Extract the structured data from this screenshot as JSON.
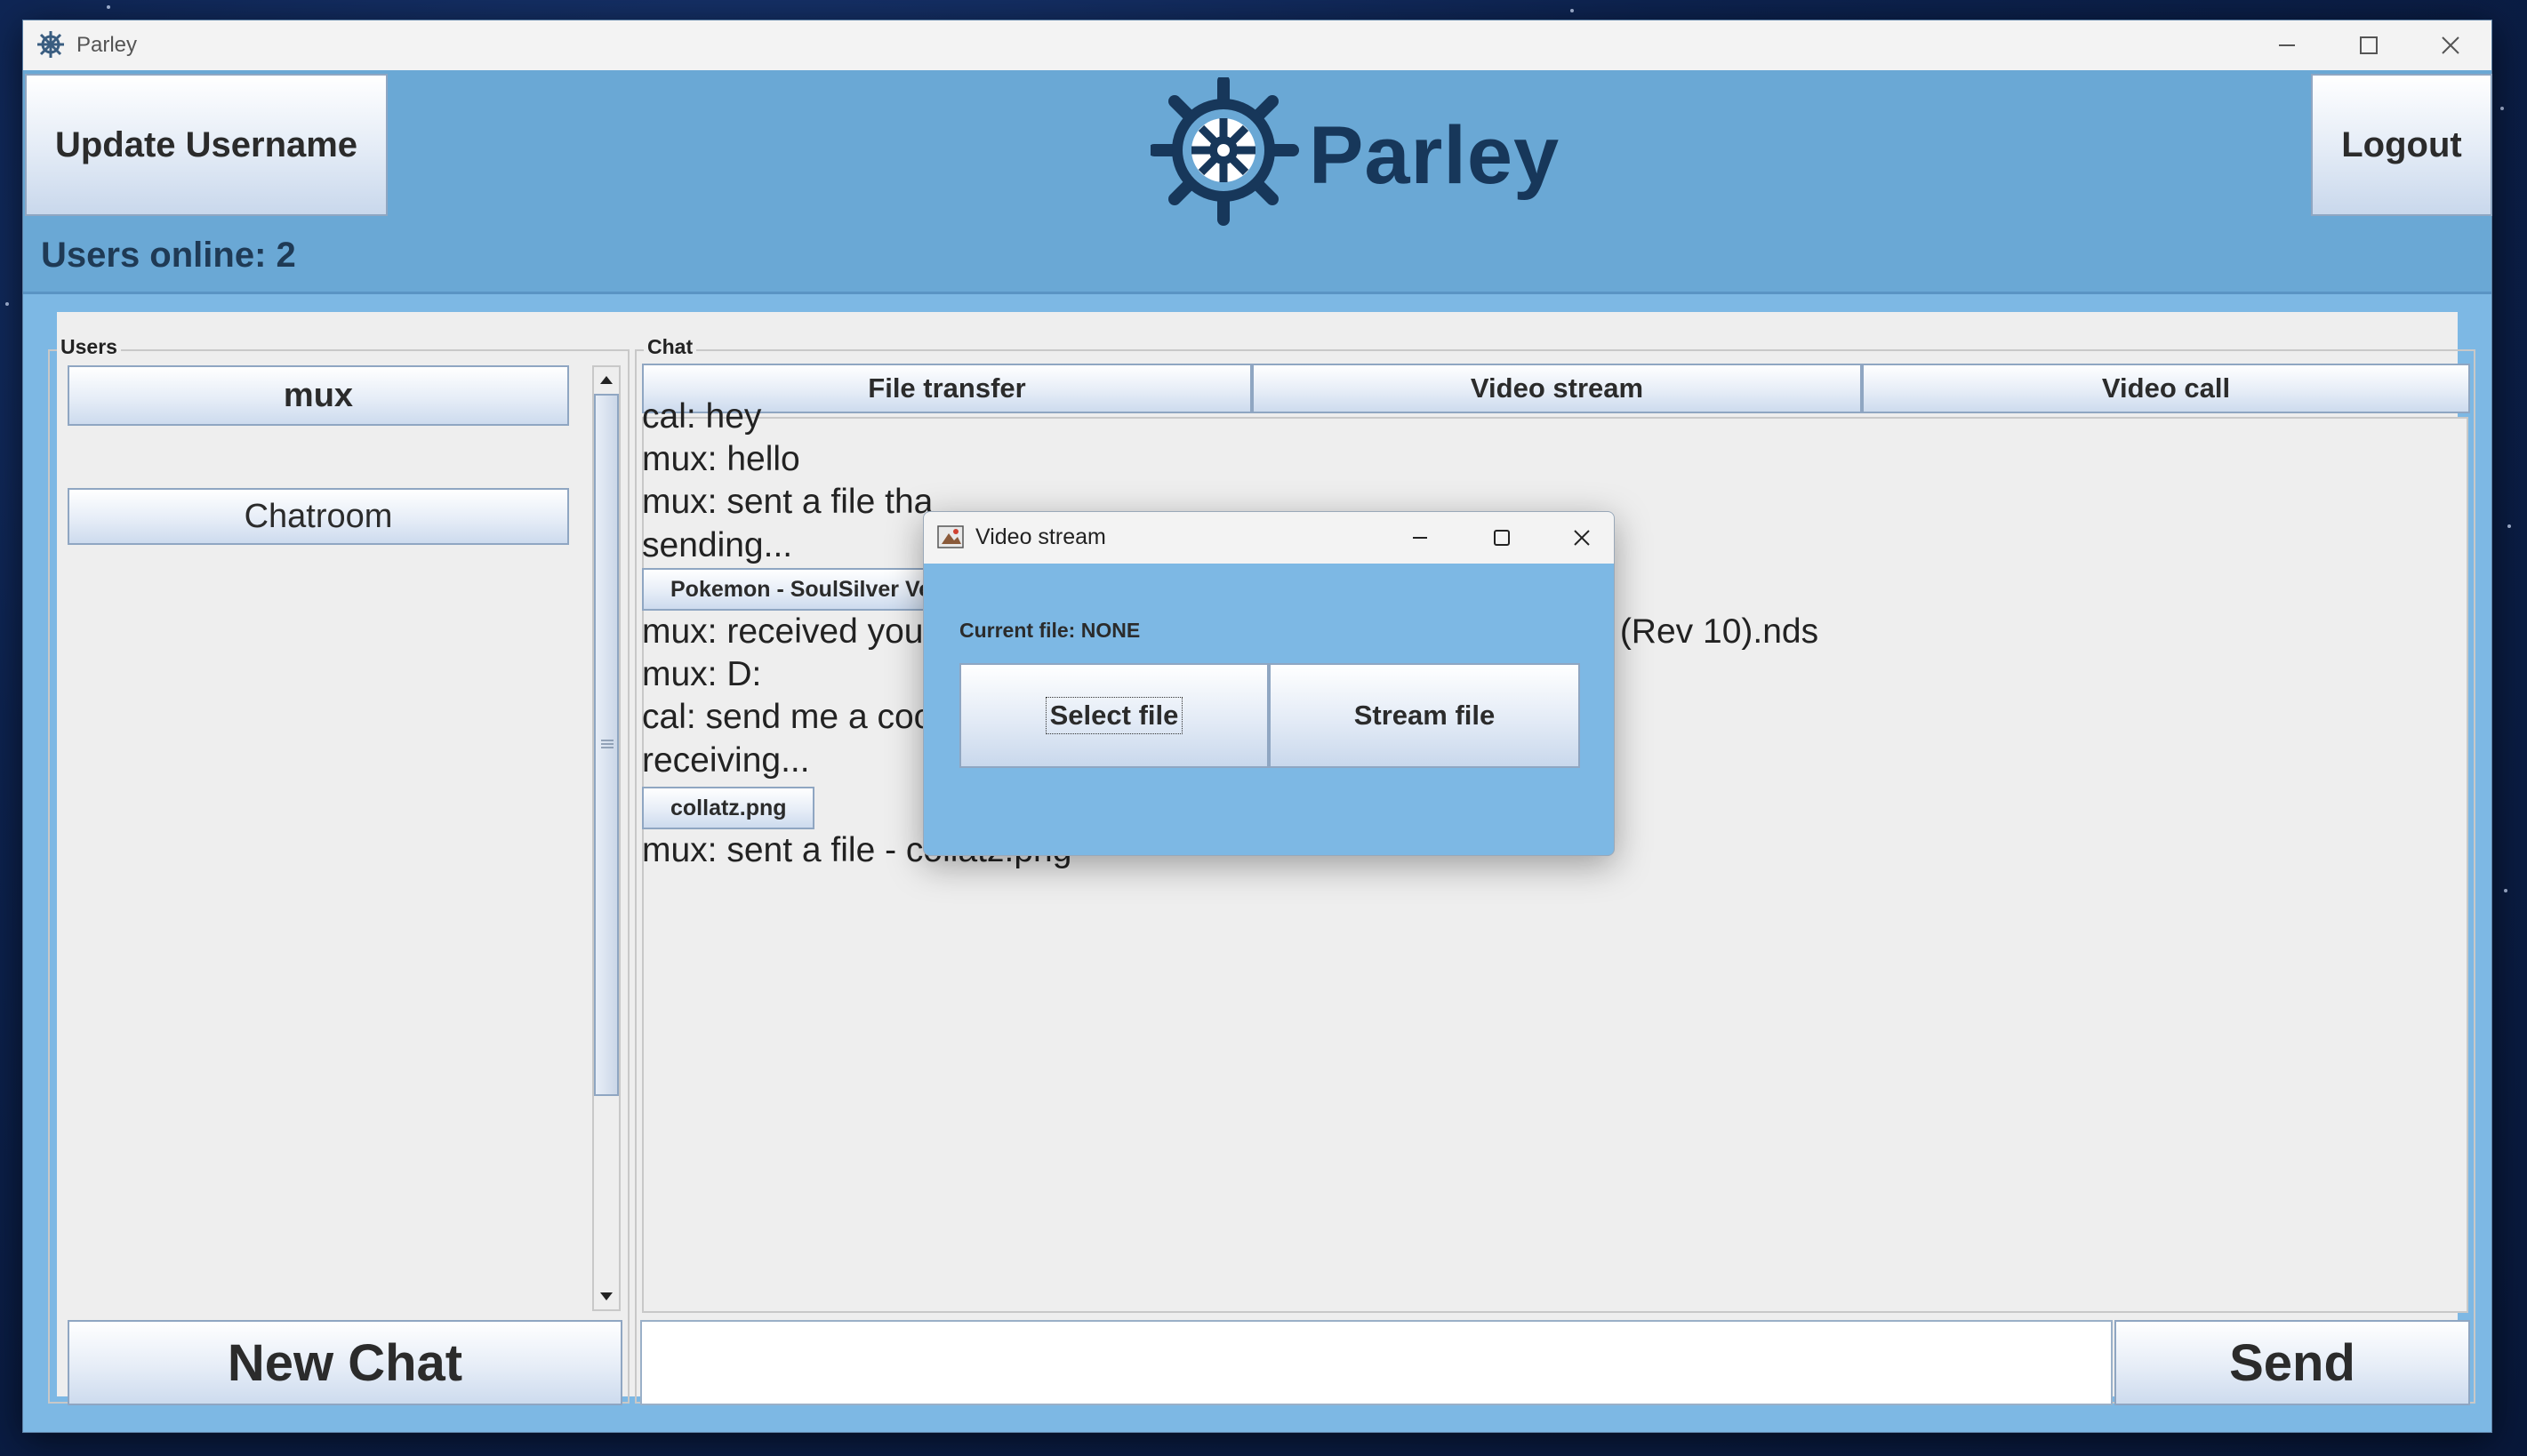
{
  "window": {
    "title": "Parley"
  },
  "header": {
    "update_username": "Update Username",
    "logout": "Logout",
    "logo_text": "Parley",
    "users_online": "Users online: 2"
  },
  "users_panel": {
    "label": "Users",
    "items": [
      "mux",
      "Chatroom"
    ],
    "new_chat": "New Chat"
  },
  "chat_panel": {
    "label": "Chat",
    "tabs": [
      "File transfer",
      "Video stream",
      "Video call"
    ],
    "messages": [
      "cal: hey",
      "mux: hello",
      "mux: sent a file tha",
      "sending...",
      "mux: received you",
      "mux: D:",
      "cal: send me a coo",
      "receiving...",
      "mux: sent a file - collatz.png"
    ],
    "msg_tail": ") (Rev 10).nds",
    "file_buttons": [
      "Pokemon - SoulSilver Ve",
      "collatz.png"
    ],
    "input_value": "",
    "send": "Send"
  },
  "dialog": {
    "title": "Video stream",
    "current_file": "Current file: NONE",
    "select_file": "Select file",
    "stream_file": "Stream file"
  }
}
